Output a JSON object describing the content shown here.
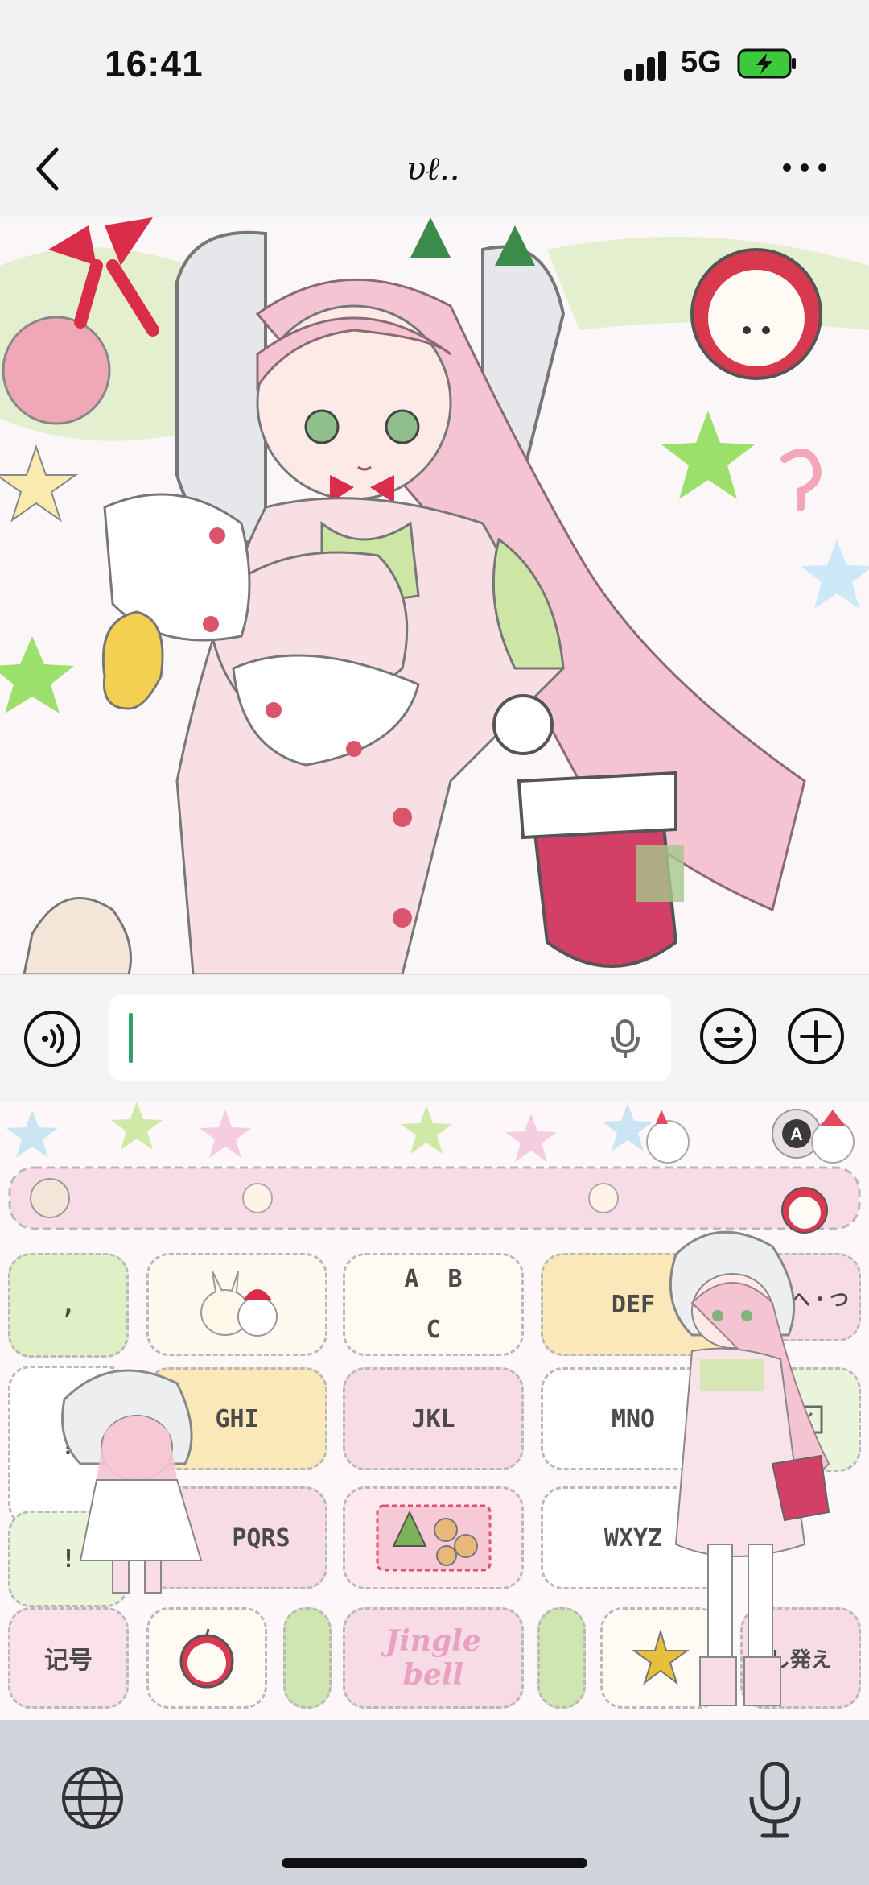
{
  "status_bar": {
    "time": "16:41",
    "network": "5G",
    "battery_charging": true
  },
  "nav": {
    "title": "υℓ..",
    "back_icon": "chevron-left-icon",
    "more_icon": "more-horizontal-icon"
  },
  "input_bar": {
    "voice_icon": "voice-mode-icon",
    "text_value": "",
    "mic_icon": "microphone-icon",
    "emoji_icon": "emoji-icon",
    "plus_icon": "plus-icon"
  },
  "keyboard": {
    "theme": "christmas-pastel",
    "symbols_key": ",",
    "keys": [
      {
        "id": "abc",
        "label_top": "A  B",
        "label_bottom": "C"
      },
      {
        "id": "def",
        "label": "DEF"
      },
      {
        "id": "ghi",
        "label": "GHI"
      },
      {
        "id": "jkl",
        "label": "JKL"
      },
      {
        "id": "mno",
        "label": "MNO"
      },
      {
        "id": "pqrs",
        "label": "PQRS"
      },
      {
        "id": "tuv",
        "label_top": "Jingle",
        "label_bottom": "bell"
      },
      {
        "id": "wxyz",
        "label": "WXYZ"
      }
    ],
    "punct_keys": [
      "?",
      "!"
    ],
    "bottom_left_label": "记号",
    "kana_row": "ど・へ・つ",
    "bottom_right_label": "し発え",
    "bottom_bar": {
      "globe_icon": "globe-icon",
      "dictation_icon": "microphone-icon"
    }
  },
  "colors": {
    "accent_green": "#2ea46a",
    "pastel_pink": "#f7dbe6",
    "pastel_green": "#cfe6b0",
    "pastel_yellow": "#fbe8b8"
  }
}
